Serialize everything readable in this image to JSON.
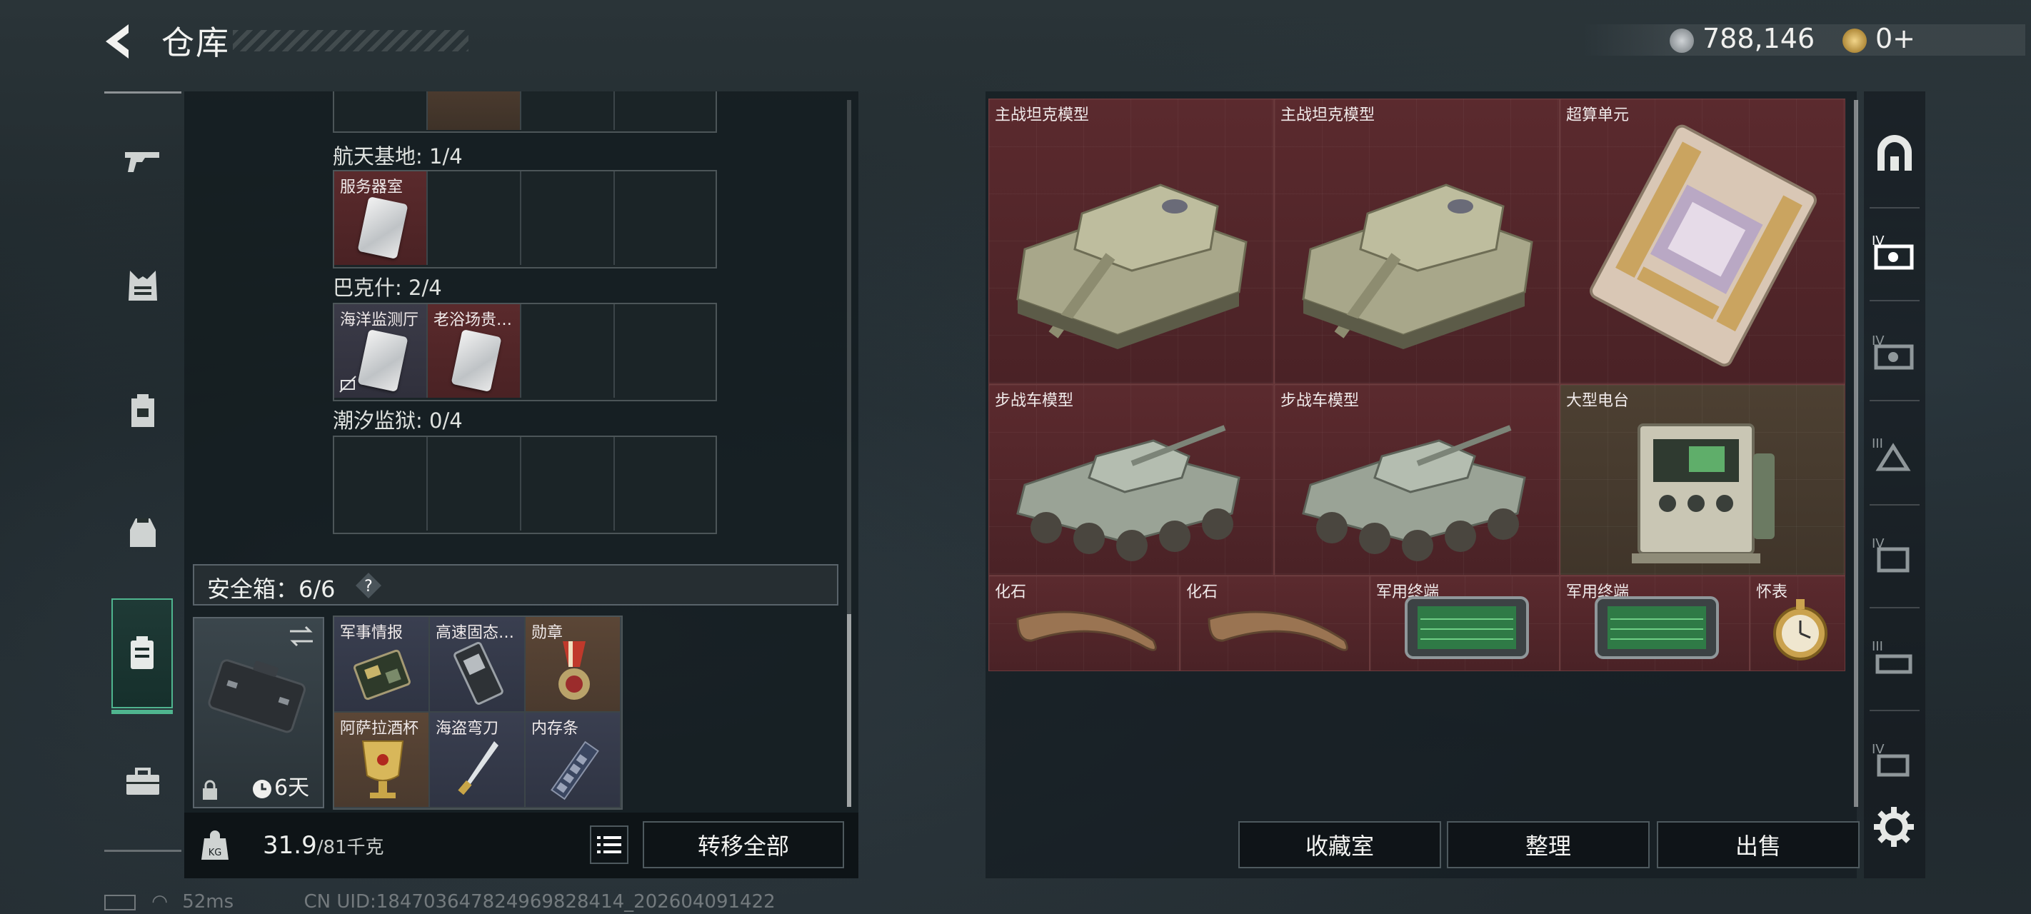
{
  "header": {
    "title": "仓库",
    "currency_1": "788,146",
    "currency_2": "0+"
  },
  "left_nav": {
    "items": [
      "weapons",
      "armor",
      "backpack",
      "pack",
      "safebox",
      "toolbox"
    ],
    "active": "safebox"
  },
  "map_sections": [
    {
      "label": "航天基地: 1/4",
      "slots": [
        {
          "name": "服务器室"
        },
        null,
        null,
        null
      ]
    },
    {
      "label": "巴克什: 2/4",
      "slots": [
        {
          "name": "海洋监测厅"
        },
        {
          "name": "老浴场贵…"
        },
        null,
        null
      ]
    },
    {
      "label": "潮汐监狱: 0/4",
      "slots": [
        null,
        null,
        null,
        null
      ]
    }
  ],
  "safebox": {
    "title": "安全箱：6/6",
    "time_left": "6天",
    "items": [
      {
        "name": "军事情报"
      },
      {
        "name": "高速固态…"
      },
      {
        "name": "勋章"
      },
      {
        "name": "阿萨拉酒杯"
      },
      {
        "name": "海盗弯刀"
      },
      {
        "name": "内存条"
      }
    ]
  },
  "capacity": {
    "current": "31.9",
    "max": "/81千克"
  },
  "buttons": {
    "transfer_all": "转移全部",
    "collection": "收藏室",
    "organize": "整理",
    "sell": "出售"
  },
  "stash_items": [
    {
      "name": "主战坦克模型"
    },
    {
      "name": "主战坦克模型"
    },
    {
      "name": "超算单元"
    },
    {
      "name": "步战车模型"
    },
    {
      "name": "步战车模型"
    },
    {
      "name": "大型电台"
    },
    {
      "name": "化石"
    },
    {
      "name": "化石"
    },
    {
      "name": "军用终端"
    },
    {
      "name": "军用终端"
    },
    {
      "name": "怀表"
    }
  ],
  "status_bar": {
    "ping": "52ms",
    "uid": "CN UID:184703647824969828414_202604091422"
  },
  "colors": {
    "accent": "#4fb58f",
    "item_red": "#5b2a2e",
    "item_olive": "#4d4032"
  }
}
